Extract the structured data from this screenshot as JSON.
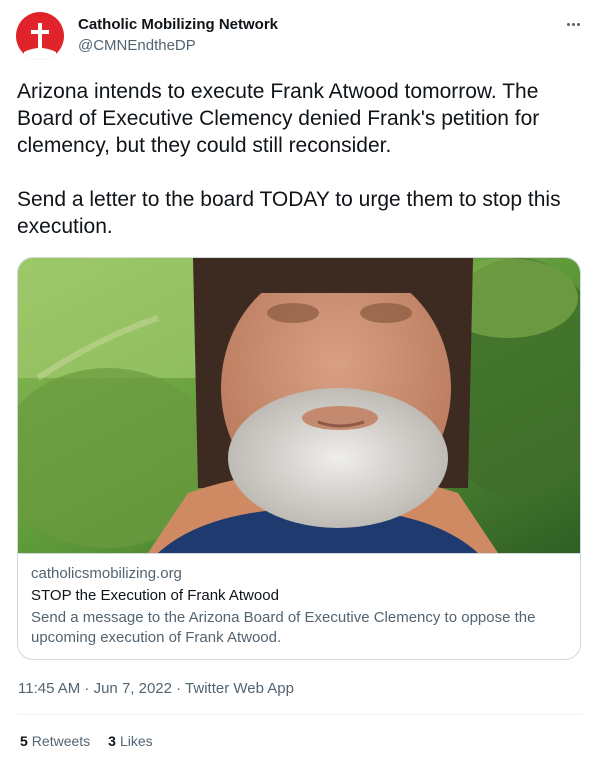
{
  "author": {
    "name": "Catholic Mobilizing Network",
    "handle": "@CMNEndtheDP",
    "avatar_color": "#e0232b",
    "avatar_icon": "cross-icon"
  },
  "more_icon": "more-options-icon",
  "tweet": {
    "paragraph1": "Arizona intends to execute Frank Atwood tomorrow. The Board of Executive Clemency denied Frank's petition for clemency, but they could still reconsider.",
    "paragraph2": "Send a letter to the board TODAY to urge them to stop this execution."
  },
  "card": {
    "domain": "catholicsmobilizing.org",
    "title": "STOP the Execution of Frank Atwood",
    "description": "Send a message to the Arizona Board of Executive Clemency to oppose the upcoming execution of Frank Atwood."
  },
  "meta": {
    "time_line": "11:45 AM · Jun 7, 2022 · Twitter Web App"
  },
  "stats": {
    "retweets_count": "5",
    "retweets_label": "Retweets",
    "likes_count": "3",
    "likes_label": "Likes"
  }
}
